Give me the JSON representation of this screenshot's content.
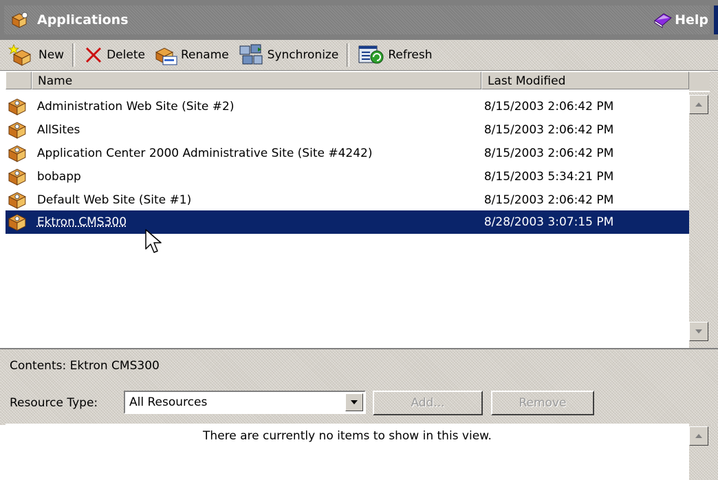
{
  "titlebar": {
    "title": "Applications",
    "help_label": "Help"
  },
  "toolbar": {
    "new_label": "New",
    "delete_label": "Delete",
    "rename_label": "Rename",
    "synchronize_label": "Synchronize",
    "refresh_label": "Refresh"
  },
  "list": {
    "columns": {
      "name": "Name",
      "last_modified": "Last Modified"
    },
    "rows": [
      {
        "name": "Administration Web Site (Site #2)",
        "modified": "8/15/2003 2:06:42 PM"
      },
      {
        "name": "AllSites",
        "modified": "8/15/2003 2:06:42 PM"
      },
      {
        "name": "Application Center 2000 Administrative Site (Site #4242)",
        "modified": "8/15/2003 2:06:42 PM"
      },
      {
        "name": "bobapp",
        "modified": "8/15/2003 5:34:21 PM"
      },
      {
        "name": "Default Web Site (Site #1)",
        "modified": "8/15/2003 2:06:42 PM"
      },
      {
        "name": "Ektron CMS300",
        "modified": "8/28/2003 3:07:15 PM"
      }
    ],
    "selected_index": 5
  },
  "lower": {
    "contents_label": "Contents: Ektron CMS300",
    "resource_type_label": "Resource Type:",
    "resource_type_value": "All Resources",
    "add_label": "Add...",
    "remove_label": "Remove",
    "empty_message": "There are currently no items to show in this view."
  },
  "colors": {
    "selection": "#0a246a",
    "face": "#d4d0c8",
    "title_gray": "#808080"
  }
}
